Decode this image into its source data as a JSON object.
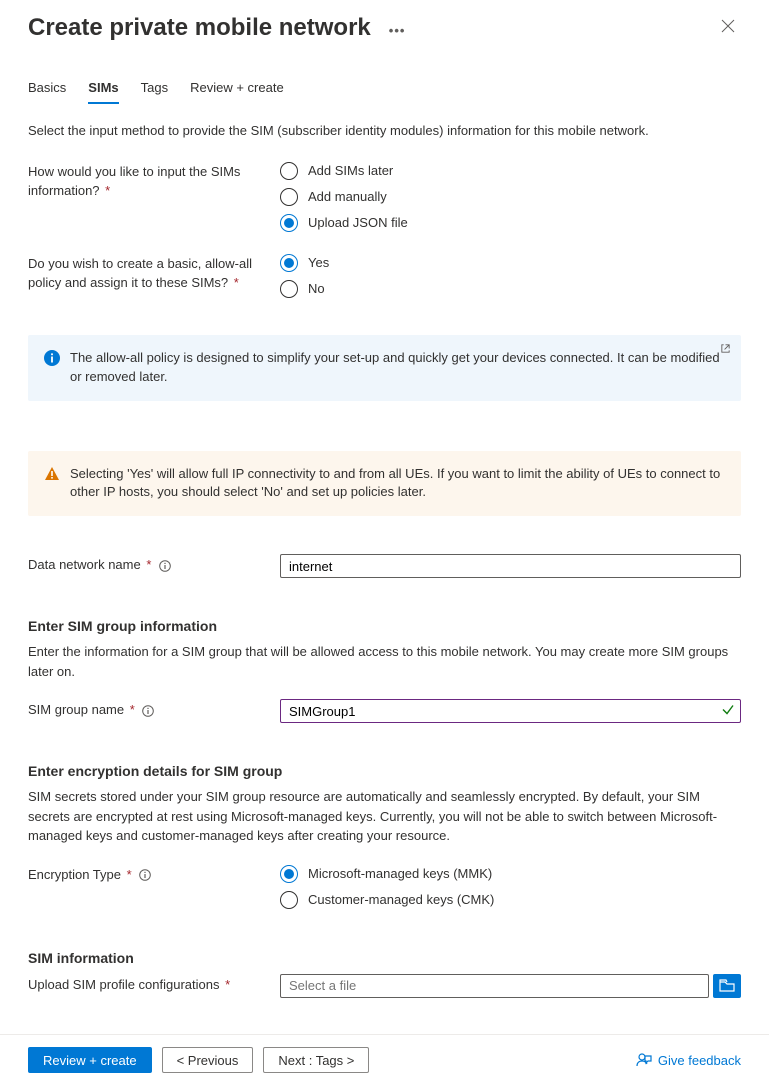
{
  "header": {
    "title": "Create private mobile network"
  },
  "tabs": [
    "Basics",
    "SIMs",
    "Tags",
    "Review + create"
  ],
  "intro": "Select the input method to provide the SIM (subscriber identity modules) information for this mobile network.",
  "q_input_method": {
    "label": "How would you like to input the SIMs information?",
    "options": [
      "Add SIMs later",
      "Add manually",
      "Upload JSON file"
    ],
    "selected": 2
  },
  "q_allow_all": {
    "label": "Do you wish to create a basic, allow-all policy and assign it to these SIMs?",
    "options": [
      "Yes",
      "No"
    ],
    "selected": 0
  },
  "info_allow_all": "The allow-all policy is designed to simplify your set-up and quickly get your devices connected. It can be modified or removed later.",
  "warn_yes": "Selecting 'Yes' will allow full IP connectivity to and from all UEs. If you want to limit the ability of UEs to connect to other IP hosts, you should select 'No' and set up policies later.",
  "data_network": {
    "label": "Data network name",
    "value": "internet"
  },
  "sim_group_section": {
    "heading": "Enter SIM group information",
    "desc": "Enter the information for a SIM group that will be allowed access to this mobile network. You may create more SIM groups later on.",
    "name_label": "SIM group name",
    "name_value": "SIMGroup1"
  },
  "encryption_section": {
    "heading": "Enter encryption details for SIM group",
    "desc": "SIM secrets stored under your SIM group resource are automatically and seamlessly encrypted. By default, your SIM secrets are encrypted at rest using Microsoft-managed keys. Currently, you will not be able to switch between Microsoft-managed keys and customer-managed keys after creating your resource.",
    "type_label": "Encryption Type",
    "options": [
      "Microsoft-managed keys (MMK)",
      "Customer-managed keys (CMK)"
    ],
    "selected": 0
  },
  "sim_info_section": {
    "heading": "SIM information",
    "upload_label": "Upload SIM profile configurations",
    "placeholder": "Select a file"
  },
  "footer": {
    "review": "Review + create",
    "previous": "<  Previous",
    "next": "Next : Tags  >",
    "feedback": "Give feedback"
  }
}
